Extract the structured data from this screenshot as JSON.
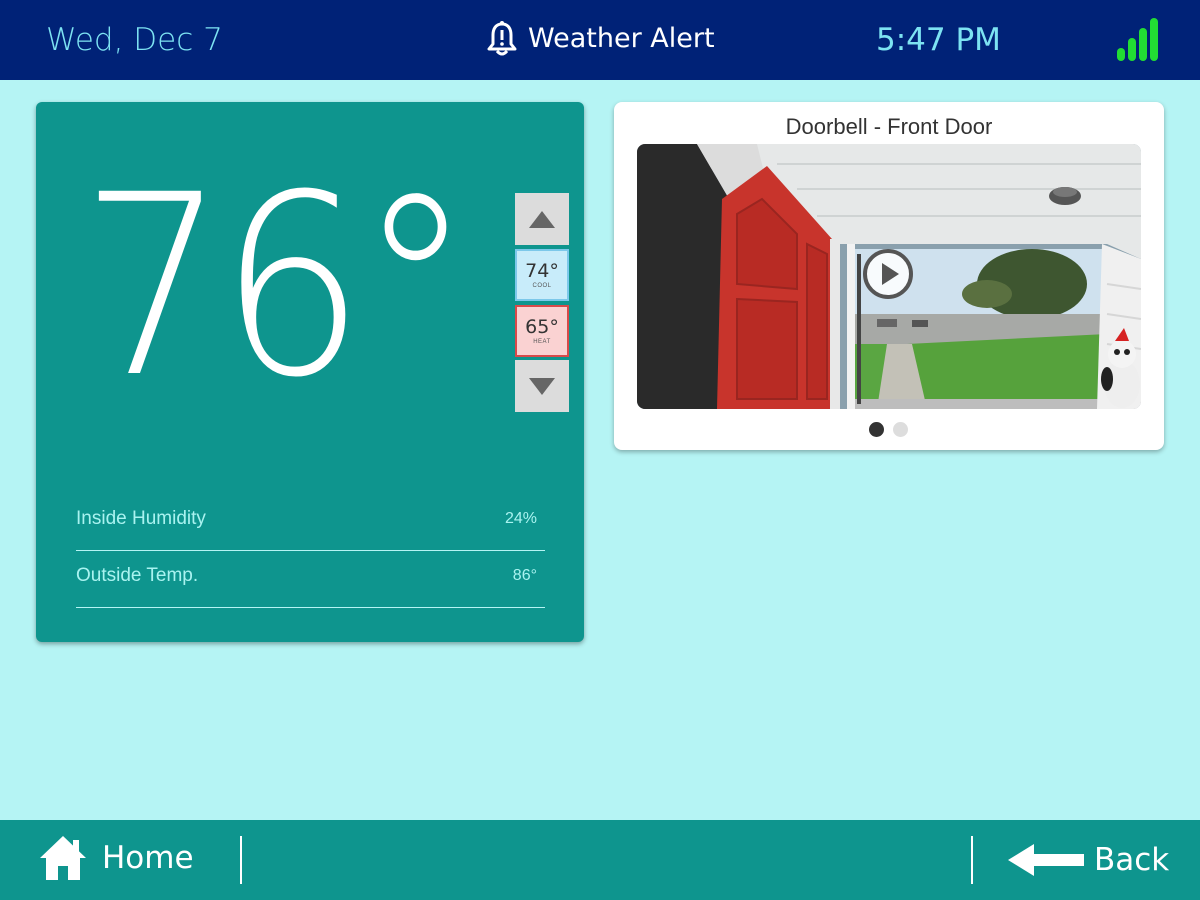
{
  "status_bar": {
    "date": "Wed, Dec 7",
    "alert_label": "Weather Alert",
    "alert_icon": "bell-alert-icon",
    "time": "5:47 PM",
    "signal_icon": "signal-strength-icon",
    "signal_color": "#22dd33"
  },
  "thermostat": {
    "current_temp": "76°",
    "cool_setpoint": "74°",
    "cool_label": "COOL",
    "heat_setpoint": "65°",
    "heat_label": "HEAT",
    "stats": [
      {
        "label": "Inside Humidity",
        "value": "24%"
      },
      {
        "label": "Outside Temp.",
        "value": "86°"
      }
    ]
  },
  "doorbell": {
    "title": "Doorbell - Front Door",
    "page_count": 2,
    "active_page": 1
  },
  "nav": {
    "home_label": "Home",
    "back_label": "Back"
  },
  "colors": {
    "top_bar": "#002277",
    "accent_teal": "#0e958e",
    "background": "#b5f4f4",
    "cool": "#c8ecfa",
    "heat": "#fad2d2"
  }
}
